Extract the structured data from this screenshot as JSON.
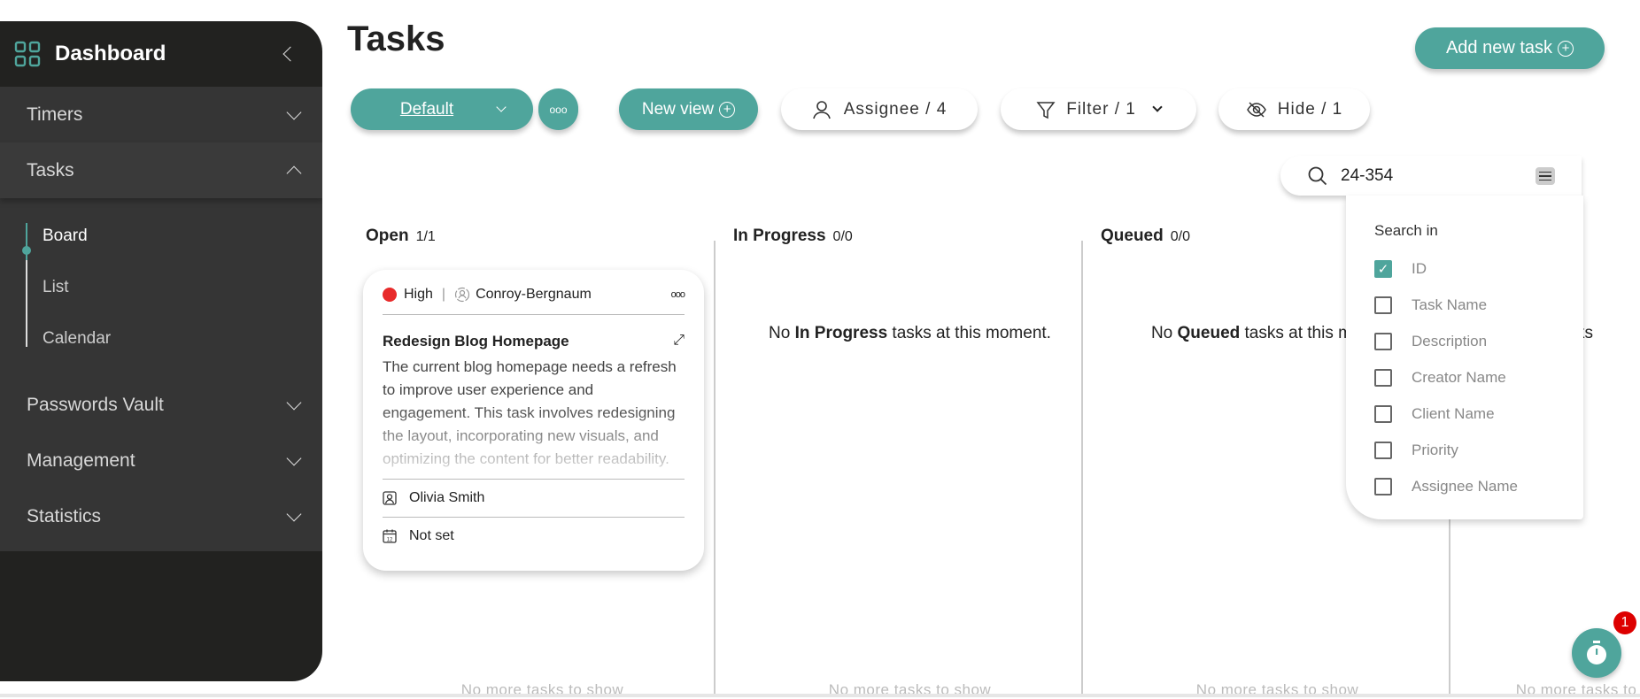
{
  "sidebar": {
    "title": "Dashboard",
    "items": [
      {
        "label": "Timers"
      },
      {
        "label": "Tasks"
      },
      {
        "label": "Passwords Vault"
      },
      {
        "label": "Management"
      },
      {
        "label": "Statistics"
      }
    ],
    "task_sub": [
      {
        "label": "Board"
      },
      {
        "label": "List"
      },
      {
        "label": "Calendar"
      }
    ]
  },
  "header": {
    "title": "Tasks",
    "add_task": "Add new task"
  },
  "toolbar": {
    "view": "Default",
    "new_view": "New view",
    "assignee": "Assignee / 4",
    "filter": "Filter / 1",
    "hide": "Hide / 1"
  },
  "search": {
    "value": "24-354",
    "search_in": "Search in",
    "options": [
      {
        "label": "ID",
        "checked": true
      },
      {
        "label": "Task Name",
        "checked": false
      },
      {
        "label": "Description",
        "checked": false
      },
      {
        "label": "Creator Name",
        "checked": false
      },
      {
        "label": "Client Name",
        "checked": false
      },
      {
        "label": "Priority",
        "checked": false
      },
      {
        "label": "Assignee Name",
        "checked": false
      }
    ]
  },
  "columns": [
    {
      "name": "Open",
      "count": "1/1",
      "footer": "No more tasks to show"
    },
    {
      "name": "In Progress",
      "count": "0/0",
      "empty_pre": "No ",
      "empty_bold": "In Progress",
      "empty_post": " tasks at this moment.",
      "footer": "No more tasks to show"
    },
    {
      "name": "Queued",
      "count": "0/0",
      "empty_pre": "No ",
      "empty_bold": "Queued",
      "empty_post": " tasks at this moment.",
      "footer": "No more tasks to show"
    },
    {
      "empty_fragment": "ks",
      "footer": "No more tasks to show"
    }
  ],
  "card": {
    "priority": "High",
    "client": "Conroy-Bergnaum",
    "title": "Redesign Blog Homepage",
    "description": "The current blog homepage needs a refresh to improve user experience and engagement. This task involves redesigning the layout, incorporating new visuals, and optimizing the content for better readability.",
    "assignee": "Olivia Smith",
    "due": "Not set",
    "priority_color": "#e82a2a"
  },
  "timer_badge": "1",
  "colors": {
    "accent": "#4fa59c",
    "sidebar": "#222220",
    "sidebar_section": "#353535"
  }
}
